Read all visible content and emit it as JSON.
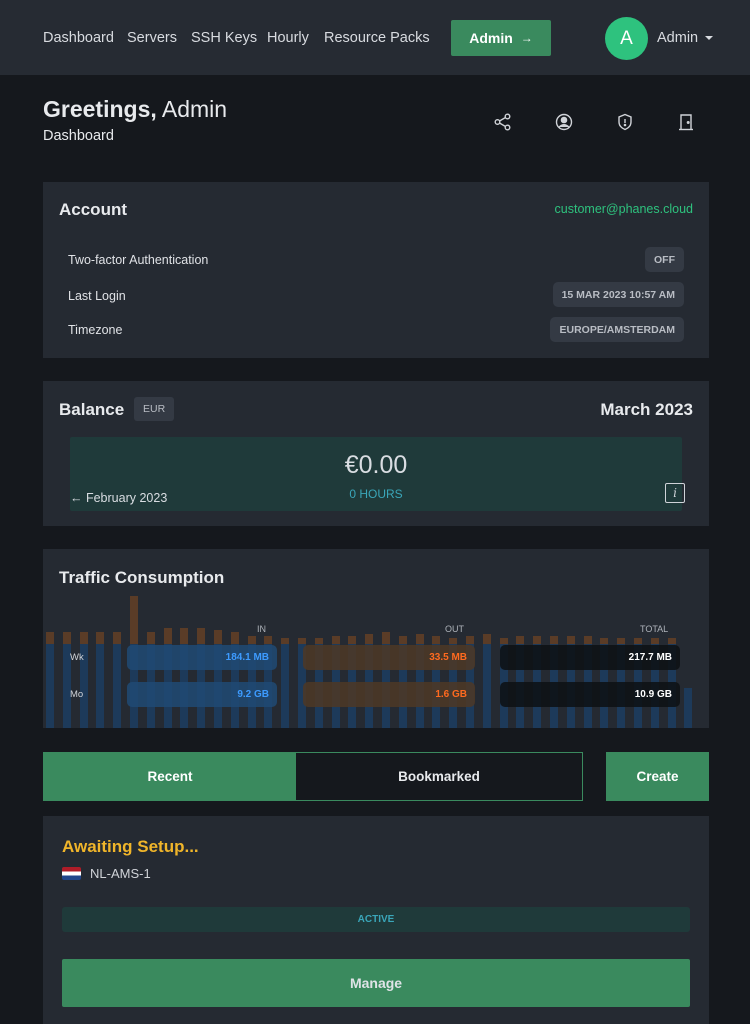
{
  "nav": {
    "links": [
      "Dashboard",
      "Servers",
      "SSH Keys",
      "Hourly",
      "Resource Packs"
    ],
    "admin_button": "Admin",
    "admin_arrow": "→",
    "avatar_initial": "A",
    "user_name": "Admin"
  },
  "header": {
    "greeting_bold": "Greetings,",
    "greeting_name": "Admin",
    "subtitle": "Dashboard",
    "icons": [
      "share-icon",
      "user-circle-icon",
      "shield-icon",
      "logout-door-icon"
    ]
  },
  "account": {
    "title": "Account",
    "email": "customer@phanes.cloud",
    "rows": [
      {
        "label": "Two-factor Authentication",
        "value": "OFF"
      },
      {
        "label": "Last Login",
        "value": "15 MAR 2023 10:57 AM"
      },
      {
        "label": "Timezone",
        "value": "EUROPE/AMSTERDAM"
      }
    ]
  },
  "balance": {
    "title": "Balance",
    "currency": "EUR",
    "month": "March 2023",
    "amount": "€0.00",
    "hours": "0 HOURS",
    "previous_month": "← February 2023",
    "info_symbol": "i"
  },
  "traffic": {
    "title": "Traffic Consumption",
    "columns": [
      "IN",
      "OUT",
      "TOTAL"
    ],
    "rows": [
      {
        "label": "Wk",
        "in": "184.1 MB",
        "out": "33.5 MB",
        "total": "217.7 MB"
      },
      {
        "label": "Mo",
        "in": "9.2 GB",
        "out": "1.6 GB",
        "total": "10.9 GB"
      }
    ],
    "colors": {
      "in": "#3d9bff",
      "out": "#ff6a1f",
      "total": "#ffffff"
    }
  },
  "tabs": {
    "recent": "Recent",
    "bookmarked": "Bookmarked",
    "create": "Create"
  },
  "server": {
    "title": "Awaiting Setup...",
    "location": "NL-AMS-1",
    "flag": "netherlands-flag-icon",
    "status": "ACTIVE",
    "manage": "Manage"
  },
  "colors": {
    "accent": "#3a8a5e",
    "avatar": "#2ec27e",
    "email": "#2ec27e",
    "warning": "#f0b52a",
    "status_teal": "#3aa6b9"
  }
}
